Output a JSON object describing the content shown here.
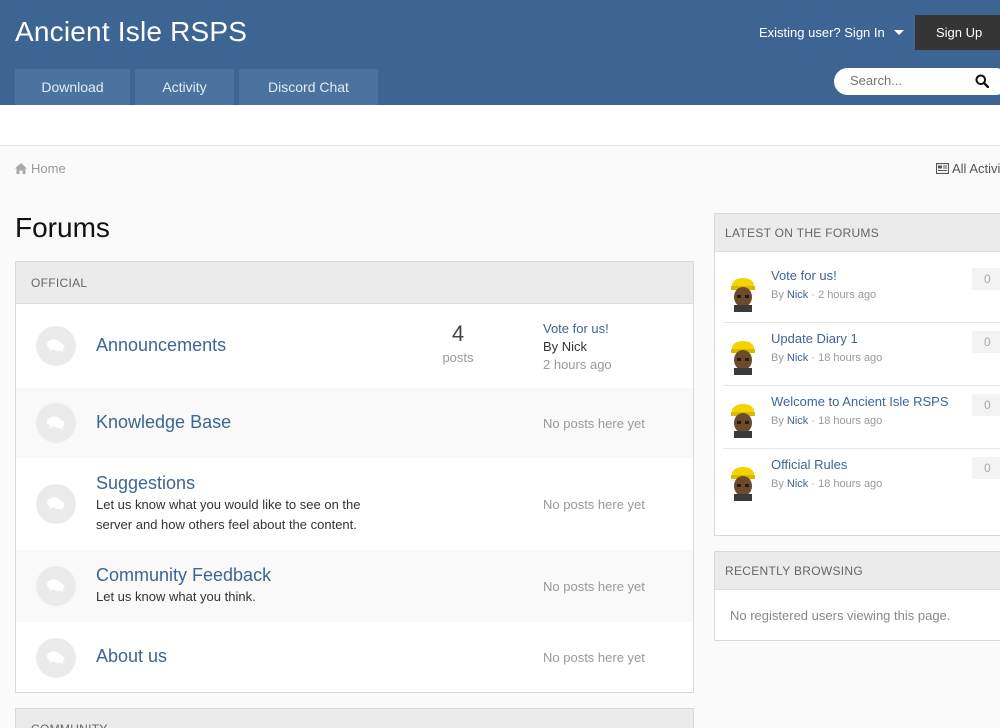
{
  "header": {
    "site_title": "Ancient Isle RSPS",
    "signin_label": "Existing user? Sign In",
    "signup_label": "Sign Up",
    "search_placeholder": "Search...",
    "nav": [
      {
        "label": "Download"
      },
      {
        "label": "Activity"
      },
      {
        "label": "Discord Chat"
      }
    ]
  },
  "breadcrumb": {
    "home_label": "Home",
    "all_activity_label": "All Activity"
  },
  "page_title": "Forums",
  "official": {
    "heading": "OFFICIAL",
    "forums": [
      {
        "name": "Announcements",
        "description": "",
        "post_count": "4",
        "post_label": "posts",
        "last_post_title": "Vote for us!",
        "last_post_by": "By Nick",
        "last_post_time": "2 hours ago"
      },
      {
        "name": "Knowledge Base",
        "description": "",
        "status": "No posts here yet"
      },
      {
        "name": "Suggestions",
        "description": "Let us know what you would like to see on the server and how others feel about the content.",
        "status": "No posts here yet"
      },
      {
        "name": "Community Feedback",
        "description": "Let us know what you think.",
        "status": "No posts here yet"
      },
      {
        "name": "About us",
        "description": "",
        "status": "No posts here yet"
      }
    ]
  },
  "community": {
    "heading": "COMMUNITY"
  },
  "latest": {
    "heading": "LATEST ON THE FORUMS",
    "topics": [
      {
        "title": "Vote for us!",
        "by": "By",
        "author": "Nick",
        "time": "· 2 hours ago",
        "replies": "0"
      },
      {
        "title": "Update Diary 1",
        "by": "By",
        "author": "Nick",
        "time": "· 18 hours ago",
        "replies": "0"
      },
      {
        "title": "Welcome to Ancient Isle RSPS",
        "by": "By",
        "author": "Nick",
        "time": "· 18 hours ago",
        "replies": "0"
      },
      {
        "title": "Official Rules",
        "by": "By",
        "author": "Nick",
        "time": "· 18 hours ago",
        "replies": "0"
      }
    ]
  },
  "browsing": {
    "heading": "RECENTLY BROWSING",
    "text": "No registered users viewing this page."
  },
  "colors": {
    "header_bg": "#3d6594",
    "nav_tab_bg": "#4b73a0",
    "link": "#3d6594",
    "signup_bg": "#353535"
  },
  "icons": {
    "forum": "chat-bubbles-icon",
    "home": "home-icon",
    "activity": "newspaper-icon",
    "search": "search-icon",
    "avatar": "miner-avatar"
  }
}
